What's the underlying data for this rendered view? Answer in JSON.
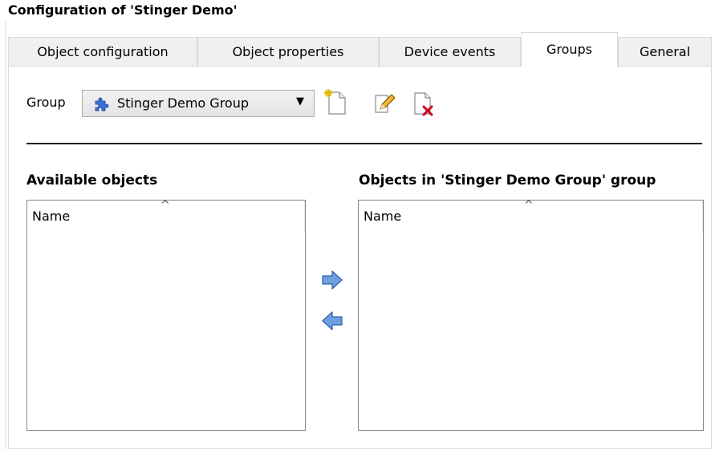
{
  "window": {
    "title": "Configuration of 'Stinger Demo'"
  },
  "tabs": [
    {
      "label": "Object configuration",
      "active": false
    },
    {
      "label": "Object properties",
      "active": false
    },
    {
      "label": "Device events",
      "active": false
    },
    {
      "label": "Groups",
      "active": true
    },
    {
      "label": "General",
      "active": false
    }
  ],
  "group": {
    "label": "Group",
    "selected": "Stinger Demo Group",
    "icon": "puzzle-icon"
  },
  "toolbar": {
    "new_icon": "new-document-icon",
    "edit_icon": "edit-pencil-icon",
    "delete_icon": "delete-document-icon"
  },
  "available": {
    "title": "Available objects",
    "column": "Name",
    "items": []
  },
  "members": {
    "title": "Objects in 'Stinger Demo Group' group",
    "column": "Name",
    "items": []
  },
  "colors": {
    "arrow": "#6f9fe0",
    "delete": "#d0021b"
  }
}
